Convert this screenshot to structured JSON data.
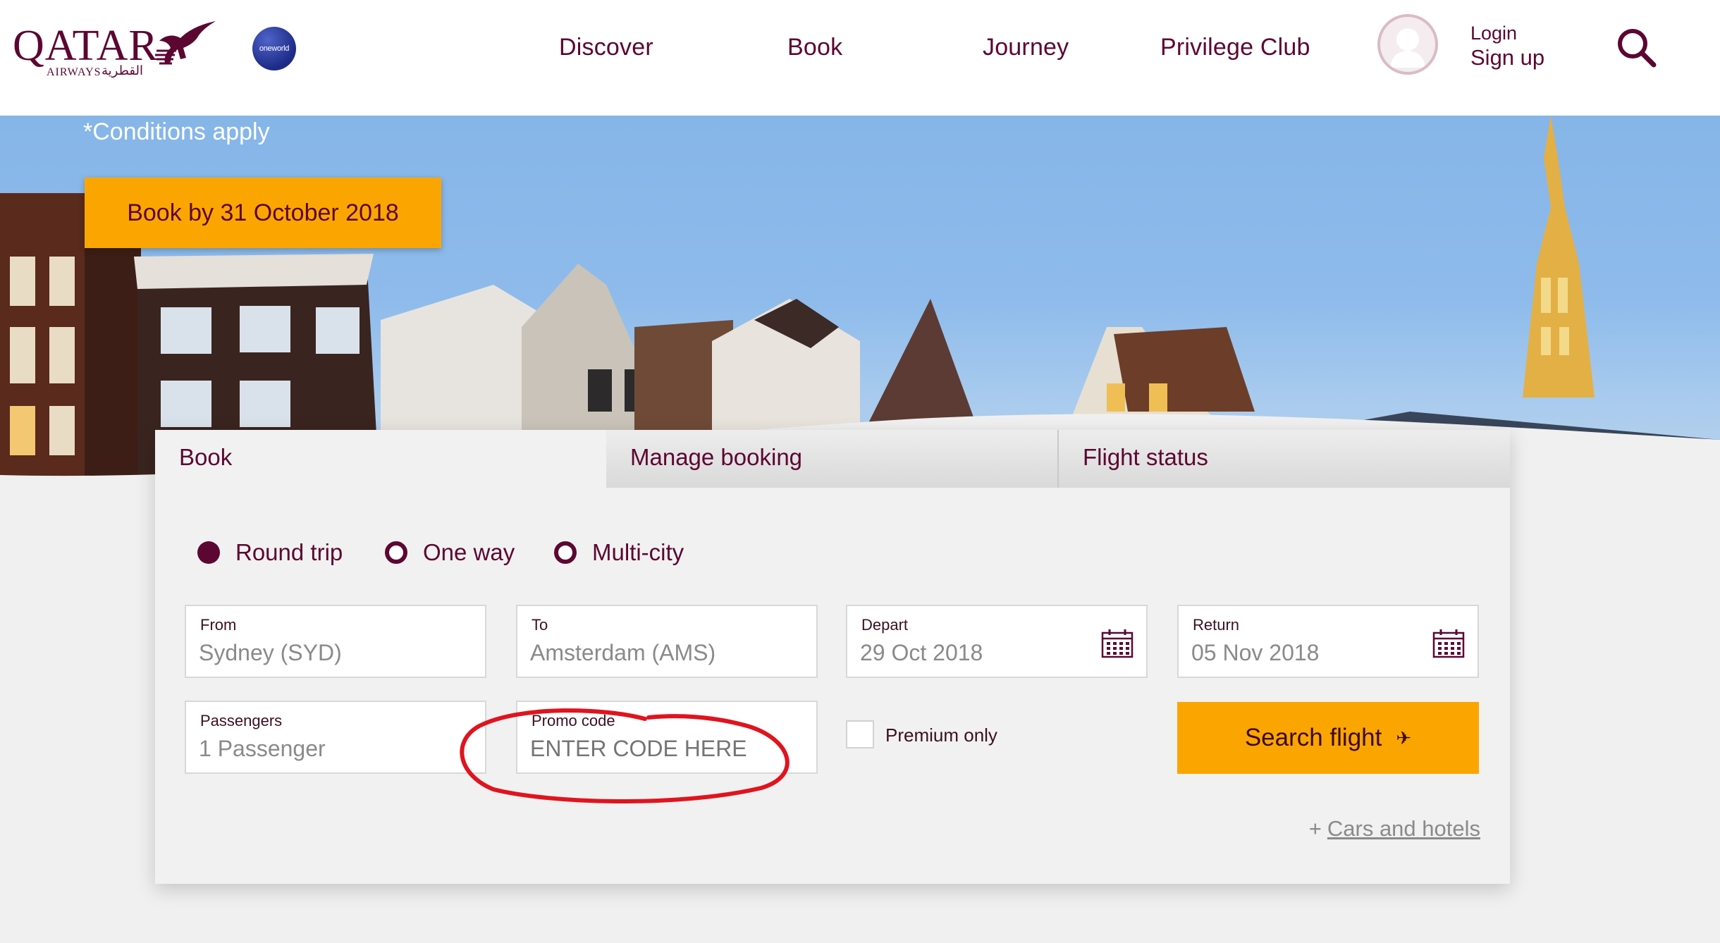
{
  "header": {
    "logo_text": "QATAR",
    "logo_sub": "AIRWAYS",
    "logo_arabic": "القطرية",
    "alliance": "oneworld",
    "nav": [
      "Discover",
      "Book",
      "Journey",
      "Privilege Club"
    ],
    "login_label": "Login",
    "signup_label": "Sign up"
  },
  "hero": {
    "conditions": "*Conditions apply",
    "cta_label": "Book by 31 October 2018"
  },
  "booking": {
    "tabs": [
      "Book",
      "Manage booking",
      "Flight status"
    ],
    "active_tab": "Book",
    "trip_types": [
      {
        "label": "Round trip",
        "selected": true
      },
      {
        "label": "One way",
        "selected": false
      },
      {
        "label": "Multi-city",
        "selected": false
      }
    ],
    "from": {
      "label": "From",
      "value": "Sydney (SYD)"
    },
    "to": {
      "label": "To",
      "value": "Amsterdam (AMS)"
    },
    "depart": {
      "label": "Depart",
      "value": "29 Oct 2018"
    },
    "return": {
      "label": "Return",
      "value": "05 Nov 2018"
    },
    "passengers": {
      "label": "Passengers",
      "value": "1 Passenger"
    },
    "promo": {
      "label": "Promo code",
      "placeholder": "ENTER CODE HERE"
    },
    "premium_only": {
      "label": "Premium only",
      "checked": false
    },
    "search_label": "Search flight",
    "cars_plus": "+",
    "cars_label": "Cars and hotels"
  },
  "colors": {
    "brand": "#5c0632",
    "accent": "#fba600",
    "annotation": "#e0141e"
  },
  "icons": [
    "oryx-logo-icon",
    "user-avatar-icon",
    "search-icon",
    "calendar-icon",
    "plane-icon"
  ]
}
